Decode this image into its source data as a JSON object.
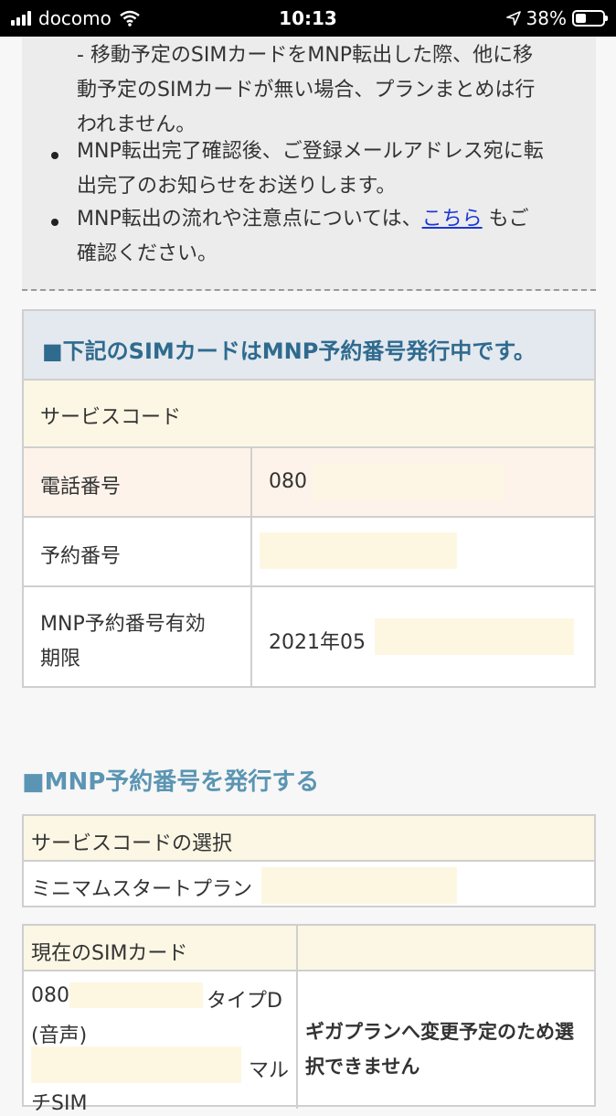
{
  "status_bar": {
    "carrier": "docomo",
    "time": "10:13",
    "battery": "38%"
  },
  "info_box": {
    "line1": "- 移動予定のSIMカードをMNP転出した際、他に移",
    "line2": "動予定のSIMカードが無い場合、プランまとめは行",
    "line3": "われません。",
    "bullet1_line1": "MNP転出完了確認後、ご登録メールアドレス宛に転",
    "bullet1_line2": "出完了のお知らせをお送りします。",
    "bullet2_pre": "MNP転出の流れや注意点については、",
    "bullet2_link": "こちら",
    "bullet2_post": "もご",
    "bullet2_line2": "確認ください。"
  },
  "reserved_table": {
    "title": "■下記のSIMカードはMNP予約番号発行中です。",
    "service_code_label": "サービスコード",
    "phone_label": "電話番号",
    "phone_value": "080",
    "reservation_label": "予約番号",
    "expiry_label_line1": "MNP予約番号有効",
    "expiry_label_line2": "期限",
    "expiry_value": "2021年05"
  },
  "issue_section": {
    "title": "■MNP予約番号を発行する",
    "service_select_header": "サービスコードの選択",
    "service_option": "ミニマムスタートプラン",
    "current_sim_header": "現在のSIMカード",
    "sim_line1_prefix": "080",
    "sim_line1_suffix": "タイプD",
    "sim_line2": "(音声)",
    "sim_line3_suffix": "マル",
    "sim_line4": "チSIM",
    "notice_line1": "ギガプランへ変更予定のため選",
    "notice_line2": "択できません"
  }
}
